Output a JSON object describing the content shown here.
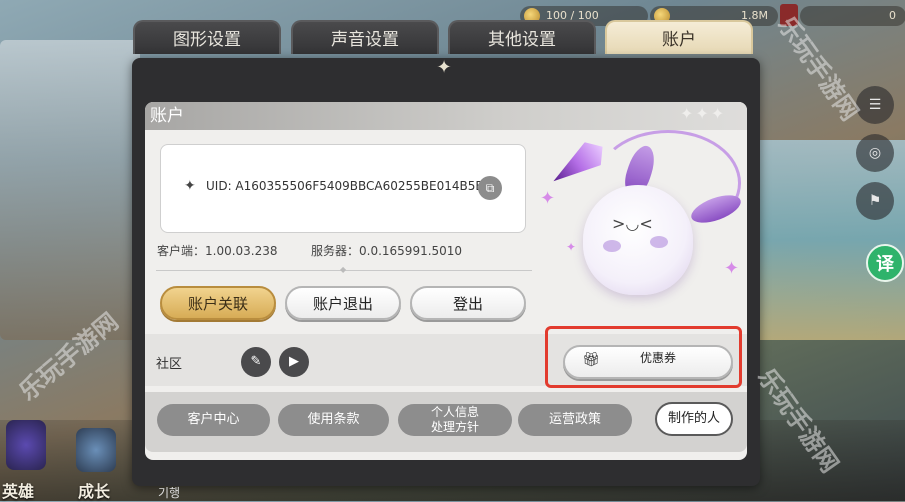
{
  "topbar": {
    "res1": "100 / 100",
    "res2": "1.8M",
    "res3": "0"
  },
  "tabs": [
    {
      "label": "图形设置",
      "active": false
    },
    {
      "label": "声音设置",
      "active": false
    },
    {
      "label": "其他设置",
      "active": false
    },
    {
      "label": "账户",
      "active": true
    }
  ],
  "panel": {
    "title": "账户",
    "uid": "UID: A160355506F5409BBCA60255BE014B5B",
    "client_version": "客户端：1.00.03.238",
    "server_version": "服务器：0.0.165991.5010"
  },
  "buttons": {
    "link_account": "账户关联",
    "logout": "账户退出",
    "login": "登出"
  },
  "community": {
    "label": "社区",
    "coupon": "优惠券"
  },
  "footer": {
    "customer_center": "客户中心",
    "terms": "使用条款",
    "privacy_line1": "个人信息",
    "privacy_line2": "处理方针",
    "operation_policy": "运营政策",
    "credits": "制作的人"
  },
  "side": {
    "translate": "译"
  },
  "watermark": "乐玩手游网",
  "bottom_nav": {
    "hero": "英雄",
    "growth": "成长",
    "partial": "기행"
  },
  "colors": {
    "accent_gold": "#d7ac56",
    "highlight_red": "#e23b2e",
    "translate_green": "#2fb36b",
    "mascot_purple": "#8a4fc3"
  }
}
